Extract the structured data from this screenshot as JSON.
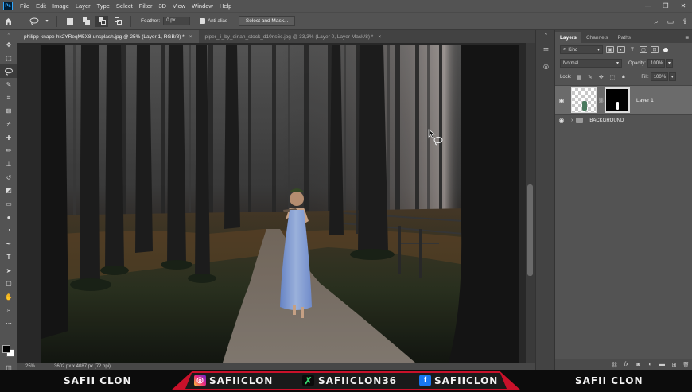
{
  "app": {
    "logo_text": "Ps",
    "menu": [
      "File",
      "Edit",
      "Image",
      "Layer",
      "Type",
      "Select",
      "Filter",
      "3D",
      "View",
      "Window",
      "Help"
    ]
  },
  "options_bar": {
    "feather_label": "Feather:",
    "feather_value": "0 px",
    "antialias_label": "Anti-alias",
    "select_mask_label": "Select and Mask..."
  },
  "tabs": [
    {
      "label": "philipp-knape-hk2YReqM5X8-unsplash.jpg @ 25% (Layer 1, RGB/8) *",
      "active": true
    },
    {
      "label": "piper_ii_by_eirian_stock_d10ns6c.jpg @ 33,3% (Layer 0, Layer Mask/8) *",
      "active": false
    }
  ],
  "tab_close_glyph": "×",
  "status": {
    "zoom": "25%",
    "dimensions": "3602 px x 4087 px (72 ppi)"
  },
  "layers_panel": {
    "tabs": [
      "Layers",
      "Channels",
      "Paths"
    ],
    "filter_kind": "Kind",
    "blend_mode": "Normal",
    "opacity_label": "Opacity:",
    "opacity_value": "100%",
    "lock_label": "Lock:",
    "fill_label": "Fill:",
    "fill_value": "100%",
    "layers": [
      {
        "name": "Layer 1",
        "selected": true
      },
      {
        "name": "BACKGROUND",
        "selected": false
      }
    ]
  },
  "banner": {
    "left_name": "SAFII CLON",
    "instagram": "SAFIICLON",
    "other": "SAFIICLON36",
    "facebook": "SAFIICLON",
    "right_name": "SAFII CLON",
    "accent_color": "#c9112a"
  },
  "icons": {
    "home": "home-icon",
    "lasso": "lasso-icon",
    "search": "search-icon",
    "eye": "eye-icon",
    "folder": "folder-icon"
  }
}
